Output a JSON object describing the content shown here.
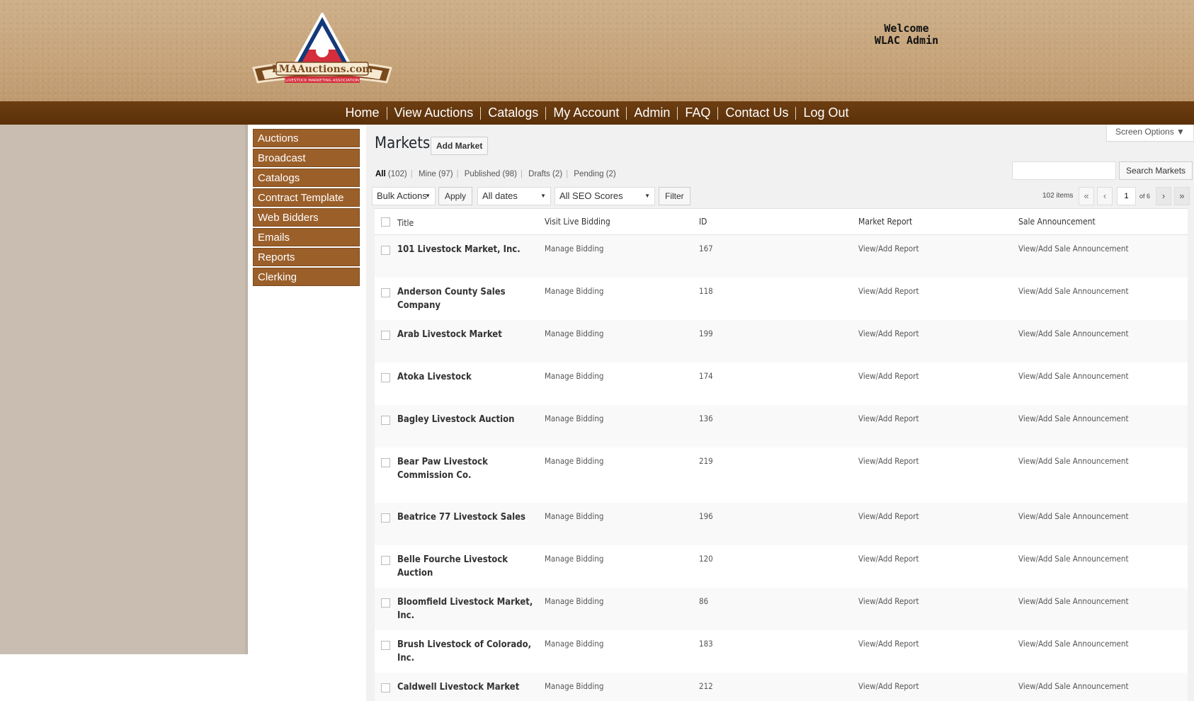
{
  "header": {
    "welcome_line1": "Welcome",
    "welcome_line2": "WLAC Admin",
    "logo": {
      "text": "LMAAuctions.com",
      "tagline": "LIVESTOCK MARKETING ASSOCIATION"
    }
  },
  "nav": [
    {
      "label": "Home"
    },
    {
      "label": "View Auctions"
    },
    {
      "label": "Catalogs"
    },
    {
      "label": "My Account"
    },
    {
      "label": "Admin"
    },
    {
      "label": "FAQ"
    },
    {
      "label": "Contact Us"
    },
    {
      "label": "Log Out"
    }
  ],
  "sidebar": [
    {
      "label": "Auctions"
    },
    {
      "label": "Broadcast"
    },
    {
      "label": "Catalogs"
    },
    {
      "label": "Contract Template"
    },
    {
      "label": "Web Bidders"
    },
    {
      "label": "Emails"
    },
    {
      "label": "Reports"
    },
    {
      "label": "Clerking"
    }
  ],
  "main": {
    "title": "Markets",
    "add_button": "Add Market",
    "screen_options": "Screen Options ▼",
    "filters": [
      {
        "label": "All",
        "count": "(102)"
      },
      {
        "label": "Mine",
        "count": "(97)"
      },
      {
        "label": "Published",
        "count": "(98)"
      },
      {
        "label": "Drafts",
        "count": "(2)"
      },
      {
        "label": "Pending",
        "count": "(2)"
      }
    ],
    "search_button": "Search Markets",
    "search_value": "",
    "bulk_actions": "Bulk Actions",
    "apply": "Apply",
    "dates": "All dates",
    "seo": "All SEO Scores",
    "filter": "Filter",
    "items_count": "102 items",
    "page": "1",
    "of_pages": "of 6",
    "pager": {
      "first": "«",
      "prev": "‹",
      "next": "›",
      "last": "»"
    },
    "columns": [
      "Title",
      "Visit Live Bidding",
      "ID",
      "Market Report",
      "Sale Announcement"
    ],
    "rows": [
      {
        "title": "101 Livestock Market, Inc.",
        "bidding": "Manage Bidding",
        "id": "167",
        "report": "View/Add Report",
        "sale": "View/Add Sale Announcement"
      },
      {
        "title": "Anderson County Sales Company",
        "bidding": "Manage Bidding",
        "id": "118",
        "report": "View/Add Report",
        "sale": "View/Add Sale Announcement"
      },
      {
        "title": "Arab Livestock Market",
        "bidding": "Manage Bidding",
        "id": "199",
        "report": "View/Add Report",
        "sale": "View/Add Sale Announcement"
      },
      {
        "title": "Atoka Livestock",
        "bidding": "Manage Bidding",
        "id": "174",
        "report": "View/Add Report",
        "sale": "View/Add Sale Announcement"
      },
      {
        "title": "Bagley Livestock Auction",
        "bidding": "Manage Bidding",
        "id": "136",
        "report": "View/Add Report",
        "sale": "View/Add Sale Announcement"
      },
      {
        "title": "Bear Paw Livestock Commission Co.",
        "bidding": "Manage Bidding",
        "id": "219",
        "report": "View/Add Report",
        "sale": "View/Add Sale Announcement"
      },
      {
        "title": "Beatrice 77 Livestock Sales",
        "bidding": "Manage Bidding",
        "id": "196",
        "report": "View/Add Report",
        "sale": "View/Add Sale Announcement"
      },
      {
        "title": "Belle Fourche Livestock Auction",
        "bidding": "Manage Bidding",
        "id": "120",
        "report": "View/Add Report",
        "sale": "View/Add Sale Announcement"
      },
      {
        "title": "Bloomfield Livestock Market, Inc.",
        "bidding": "Manage Bidding",
        "id": "86",
        "report": "View/Add Report",
        "sale": "View/Add Sale Announcement"
      },
      {
        "title": "Brush Livestock of Colorado, Inc.",
        "bidding": "Manage Bidding",
        "id": "183",
        "report": "View/Add Report",
        "sale": "View/Add Sale Announcement"
      },
      {
        "title": "Caldwell Livestock Market",
        "bidding": "Manage Bidding",
        "id": "212",
        "report": "View/Add Report",
        "sale": "View/Add Sale Announcement"
      }
    ]
  }
}
